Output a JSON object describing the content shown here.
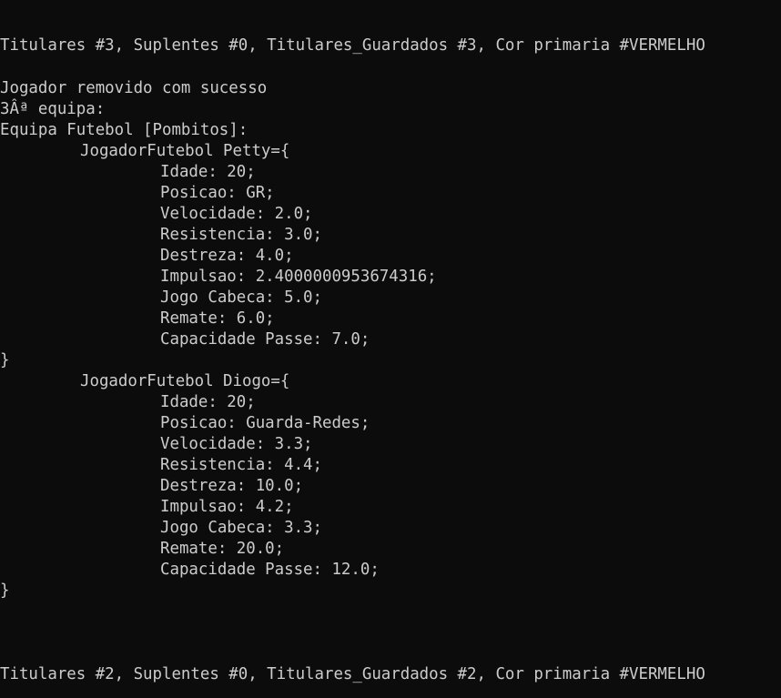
{
  "terminal": {
    "status_top": "Titulares #3, Suplentes #0, Titulares_Guardados #3, Cor primaria #VERMELHO",
    "removed_msg": "Jogador removido com sucesso",
    "team_index": "3Âª equipa:",
    "team_header": "Equipa Futebol [Pombitos]:",
    "players": [
      {
        "header": "JogadorFutebol Petty={",
        "attributes": [
          "Idade: 20;",
          "Posicao: GR;",
          "Velocidade: 2.0;",
          "Resistencia: 3.0;",
          "Destreza: 4.0;",
          "Impulsao: 2.4000000953674316;",
          "Jogo Cabeca: 5.0;",
          "Remate: 6.0;",
          "Capacidade Passe: 7.0;"
        ],
        "close": "}"
      },
      {
        "header": "JogadorFutebol Diogo={",
        "attributes": [
          "Idade: 20;",
          "Posicao: Guarda-Redes;",
          "Velocidade: 3.3;",
          "Resistencia: 4.4;",
          "Destreza: 10.0;",
          "Impulsao: 4.2;",
          "Jogo Cabeca: 3.3;",
          "Remate: 20.0;",
          "Capacidade Passe: 12.0;"
        ],
        "close": "}"
      }
    ],
    "status_bottom": "Titulares #2, Suplentes #0, Titulares_Guardados #2, Cor primaria #VERMELHO"
  }
}
